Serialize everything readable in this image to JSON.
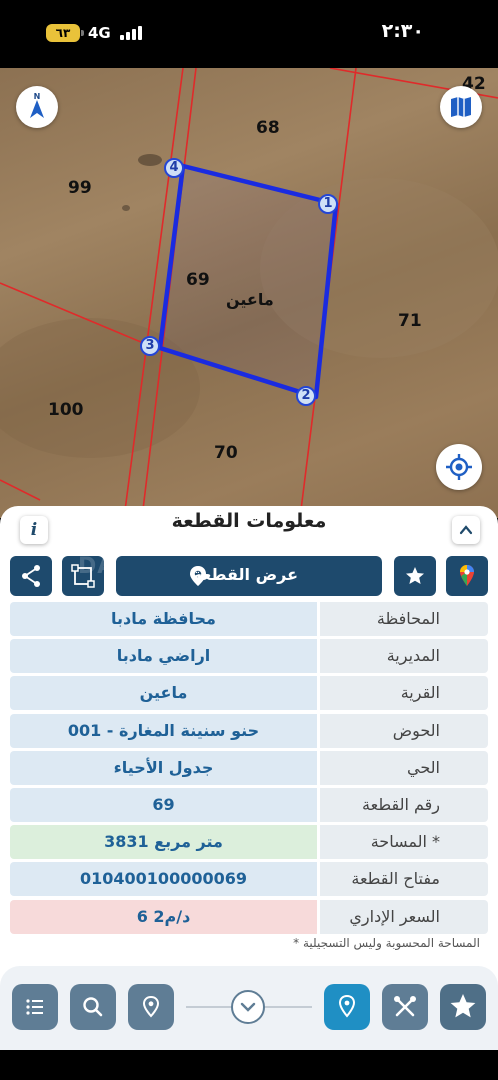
{
  "status_bar": {
    "battery": "٦٣",
    "network": "4G",
    "time": "٢:٣٠"
  },
  "map": {
    "plot_numbers": [
      "42",
      "68",
      "99",
      "69",
      "71",
      "100",
      "70"
    ],
    "district_label": "ماعين",
    "vertices": [
      "1",
      "2",
      "3",
      "4"
    ],
    "boundary_color": "#1a2be0",
    "parcel_line_color": "#e02a2a"
  },
  "panel": {
    "title": "معلومات القطعة",
    "info_icon_text": "i",
    "view_parcel_label": "عرض القطعة",
    "watermark": "DALEEL AQAR",
    "rows": [
      {
        "label": "المحافظة",
        "value": "محافظة مادبا"
      },
      {
        "label": "المديرية",
        "value": "اراضي مادبا"
      },
      {
        "label": "القرية",
        "value": "ماعين"
      },
      {
        "label": "الحوض",
        "value": "حنو سنينة المغارة - 001"
      },
      {
        "label": "الحي",
        "value": "جدول الأحياء"
      },
      {
        "label": "رقم القطعة",
        "value": "69"
      },
      {
        "label": "المساحة *",
        "value": "3831  متر مربع"
      },
      {
        "label": "مفتاح القطعة",
        "value": "010400100000069"
      },
      {
        "label": "السعر الإداري",
        "value": "6 د/م2"
      }
    ],
    "footnote": "* المساحة المحسوبة وليس التسجيلية"
  },
  "toolbar": {
    "icons": [
      "list-icon",
      "search-icon",
      "location-pin-icon",
      "chevron-down-icon",
      "map-pin-active-icon",
      "tools-icon",
      "star-icon"
    ]
  }
}
